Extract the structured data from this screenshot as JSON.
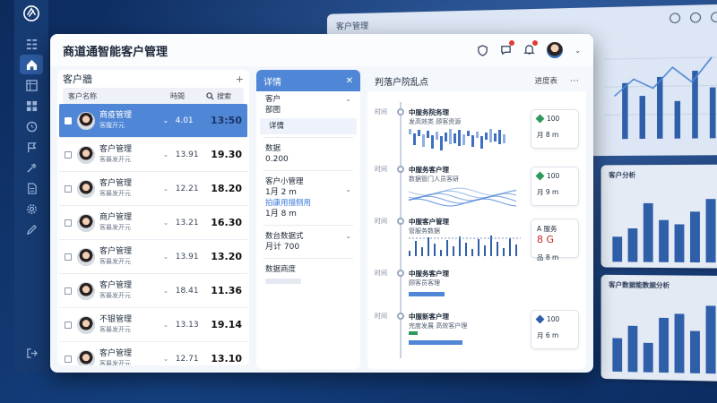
{
  "app": {
    "title": "商道通智能客户管理",
    "colors": {
      "accent": "#4f86d6",
      "rail": "#163b73",
      "bg": "#0f2f63"
    }
  },
  "rail": {
    "icons": [
      "logo-icon",
      "grid-icon",
      "home-icon",
      "table-icon",
      "apps-icon",
      "clock-icon",
      "flag-icon",
      "tools-icon",
      "document-icon",
      "gear-icon",
      "edit-icon",
      "exit-icon"
    ]
  },
  "header": {
    "icons": [
      "shield-icon",
      "message-icon",
      "bell-icon",
      "user-avatar"
    ]
  },
  "customer_list": {
    "title": "客户牆",
    "add": "+",
    "columns": {
      "name": "客户名称",
      "date": "時間",
      "search": "搜索"
    },
    "rows": [
      {
        "name": "商疫管理",
        "sub": "客魔开元",
        "date": "4.01",
        "value": "13:50"
      },
      {
        "name": "客户管理",
        "sub": "客最发开元",
        "date": "13.91",
        "value": "19.30"
      },
      {
        "name": "客户管理",
        "sub": "客最发开元",
        "date": "12.21",
        "value": "18.20"
      },
      {
        "name": "商户管理",
        "sub": "客最发开元",
        "date": "13.21",
        "value": "16.30"
      },
      {
        "name": "客户管理",
        "sub": "客最发开元",
        "date": "13.91",
        "value": "13.20"
      },
      {
        "name": "客户管理",
        "sub": "客最发开元",
        "date": "18.41",
        "value": "11.36"
      },
      {
        "name": "不银管理",
        "sub": "客最发开元",
        "date": "13.13",
        "value": "19.14"
      },
      {
        "name": "客户管理",
        "sub": "客最发开元",
        "date": "12.71",
        "value": "13.10"
      }
    ]
  },
  "detail": {
    "title": "详情",
    "close": "✕",
    "sections": [
      {
        "l1": "客户",
        "l2": "部图",
        "l3": "详情"
      },
      {
        "l1": "数据",
        "l2": "0.200"
      },
      {
        "l1": "客户小管理",
        "l2": "1月 2 m",
        "l3": "拍康用描侧用",
        "l4": "1月 8 m"
      },
      {
        "l1": "数台数据式",
        "l2": "月计 700"
      },
      {
        "l1": "数据商度",
        "l2": ""
      }
    ]
  },
  "timeline": {
    "title": "判落户院乱点",
    "tab": "进度表",
    "more": "⋯",
    "items": [
      {
        "date": "时间",
        "title": "中服务院务理",
        "sub": "发高效类 顾客资源"
      },
      {
        "date": "时间",
        "title": "中服务客户理",
        "sub": "数据管门人员客研"
      },
      {
        "date": "时间",
        "title": "中服客户管理",
        "sub": "管服务数据"
      },
      {
        "date": "时间",
        "title": "中服务客户理",
        "sub": "顾客员客理"
      },
      {
        "date": "时间",
        "title": "中服新客户理",
        "sub": "完度发展 高效客户理"
      }
    ],
    "kpis": [
      {
        "v1": "100",
        "v2": "月 8 m"
      },
      {
        "v1": "100",
        "v2": "月 9 m"
      },
      {
        "v1": "A 服务",
        "v2": "品 8 m",
        "red": "8 G"
      },
      {
        "v1": "100",
        "v2": "月 6 m"
      }
    ]
  },
  "bg_dashboard": {
    "topbar": "客户管理",
    "card1_title": "客户分析",
    "card2_title": "客户数据能数据分析",
    "bars1": [
      30,
      40,
      70,
      50,
      45,
      60,
      75
    ],
    "bars2": [
      40,
      55,
      35,
      65,
      70,
      50,
      80
    ]
  }
}
